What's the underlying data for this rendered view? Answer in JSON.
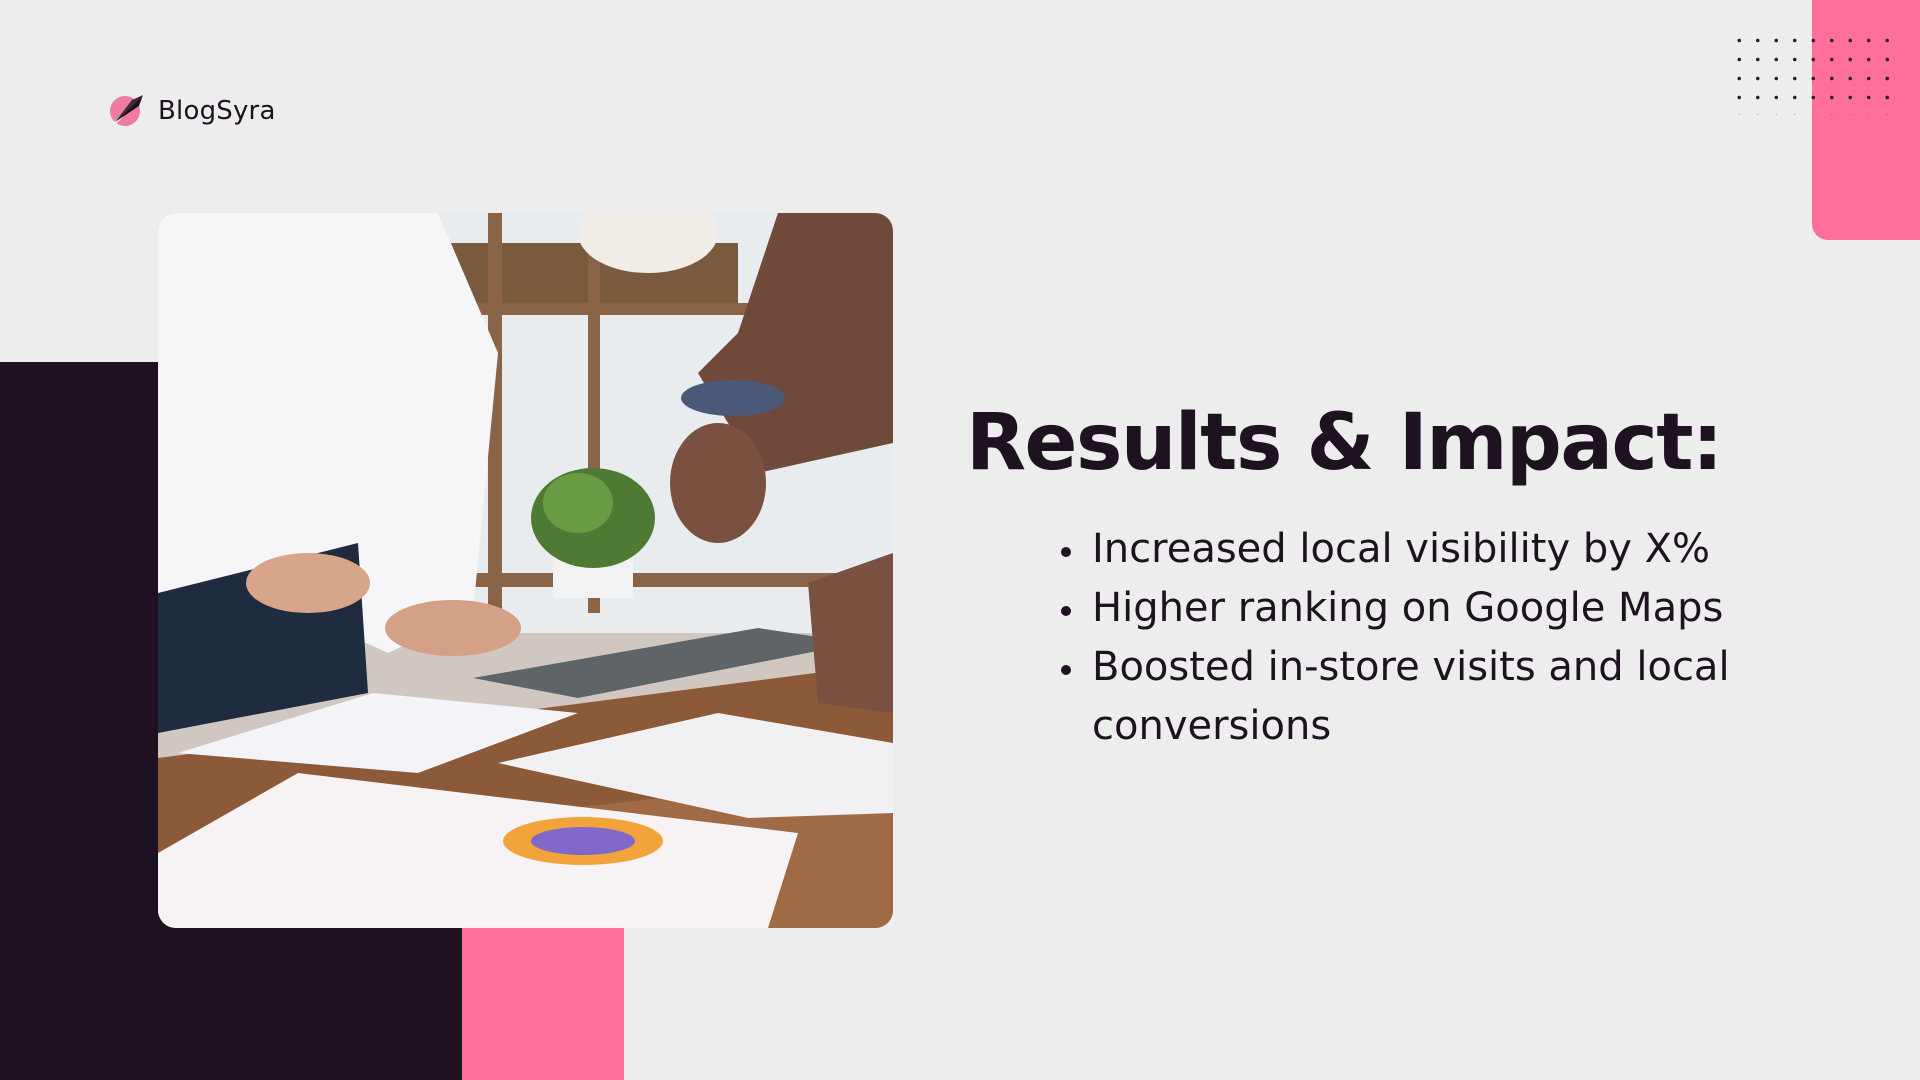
{
  "logo": {
    "text": "BlogSyra",
    "icon": "rocket-logo-icon"
  },
  "slide": {
    "title": "Results & Impact:",
    "bullets": [
      "Increased local visibility by X%",
      "Higher ranking on Google Maps",
      "Boosted in-store visits and local conversions"
    ]
  },
  "colors": {
    "background": "#ededed",
    "dark": "#1e1220",
    "accent_pink": "#fe6f9b"
  },
  "photo": {
    "subject": "team-meeting-photo"
  }
}
